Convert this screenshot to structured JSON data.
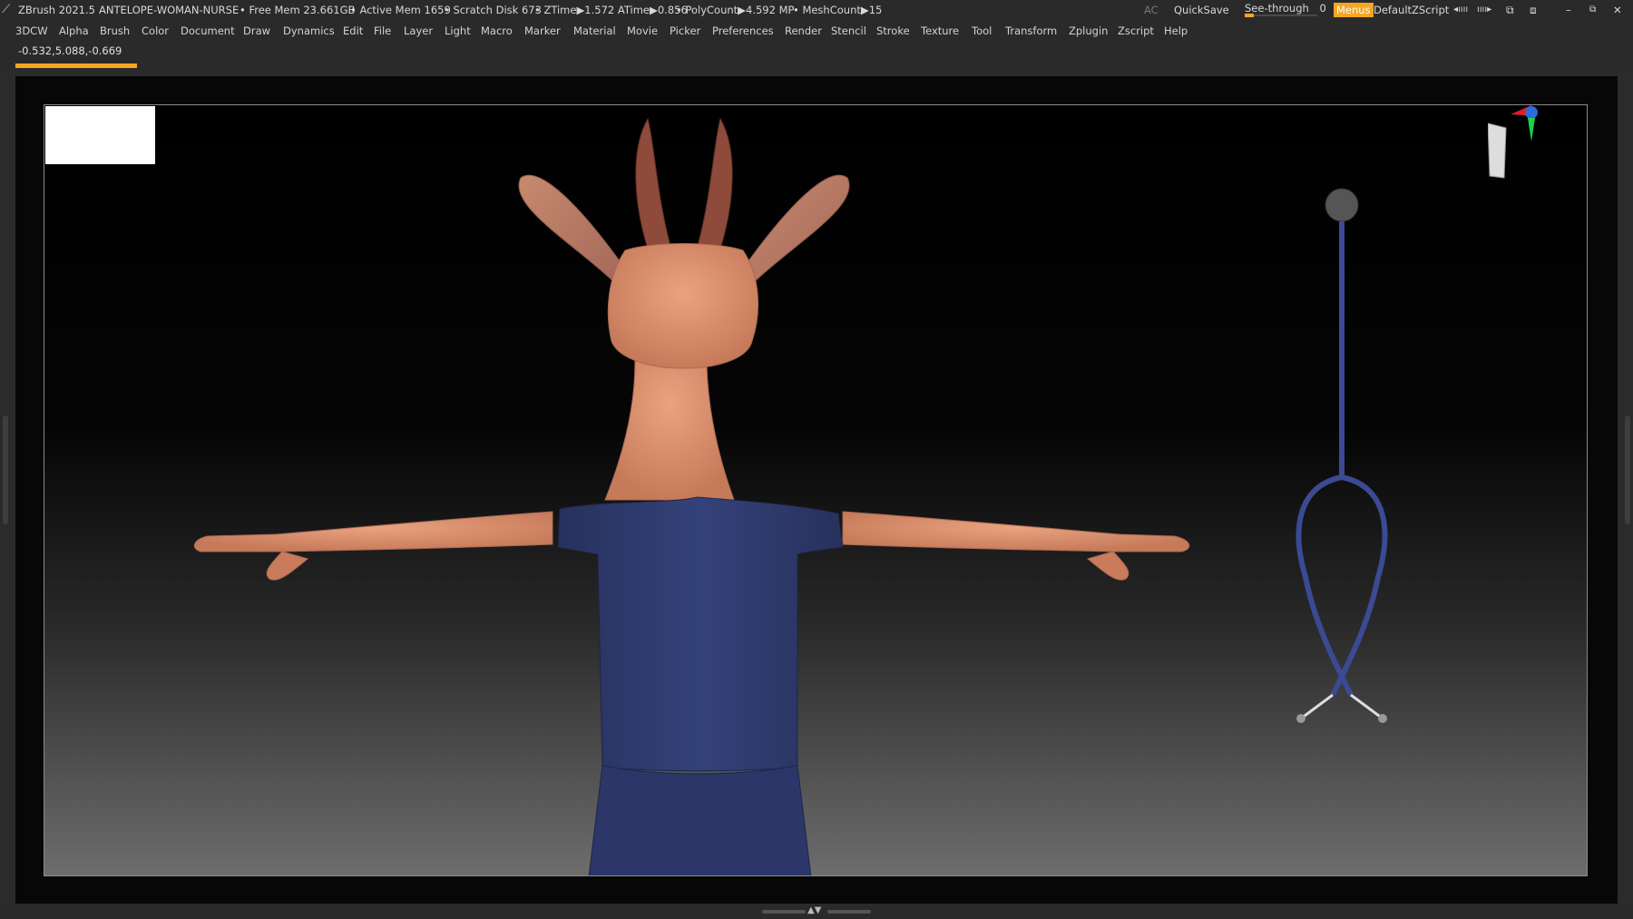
{
  "titlebar": {
    "app_title": "ZBrush 2021.5",
    "document_name": "ANTELOPE-WOMAN-NURSE",
    "free_mem": "• Free Mem 23.661GB",
    "active_mem": "• Active Mem 1659",
    "scratch_disk": "• Scratch Disk 673",
    "ztime": "• ZTime▶1.572 ATime▶0.856",
    "polycount": "• PolyCount▶4.592 MP",
    "meshcount": "• MeshCount▶15",
    "ac_label": "AC",
    "quicksave_label": "QuickSave",
    "see_through_label": "See-through",
    "see_through_value": "0",
    "menus_label": "Menus",
    "default_zscript_label": "DefaultZScript"
  },
  "menubar": {
    "items": [
      "3DCW",
      "Alpha",
      "Brush",
      "Color",
      "Document",
      "Draw",
      "Dynamics",
      "Edit",
      "File",
      "Layer",
      "Light",
      "Macro",
      "Marker",
      "Material",
      "Movie",
      "Picker",
      "Preferences",
      "Render",
      "Stencil",
      "Stroke",
      "Texture",
      "Tool",
      "Transform",
      "Zplugin",
      "Zscript",
      "Help"
    ]
  },
  "status": {
    "coordinates": "-0.532,5.088,-0.669"
  },
  "colors": {
    "accent": "#f5a623",
    "skin": "#d98c6c",
    "shirt": "#2d3a6e",
    "tube": "#2a3770"
  },
  "icons": {
    "app": "zbrush-logo-icon",
    "navcube": "navigation-cube-icon",
    "axis": "axis-gizmo-icon"
  }
}
